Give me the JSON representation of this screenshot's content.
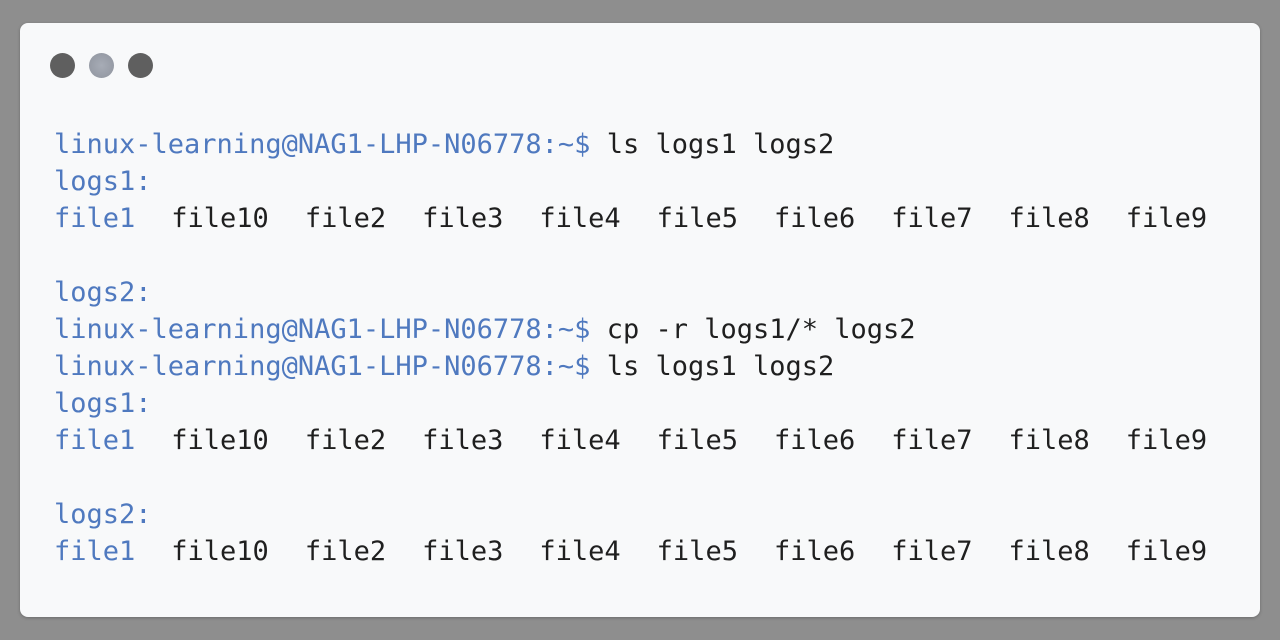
{
  "window": {
    "controls": [
      "close",
      "minimize",
      "maximize"
    ]
  },
  "colors": {
    "prompt": "#4f79bf",
    "text": "#1f1f1f",
    "window_bg": "#f8f9fa",
    "desktop_bg": "#8e8e8e"
  },
  "terminal": {
    "prompt": "linux-learning@NAG1-LHP-N06778:~$",
    "blocks": [
      {
        "type": "command",
        "text": "ls logs1 logs2"
      },
      {
        "type": "dir",
        "text": "logs1:"
      },
      {
        "type": "files",
        "items": [
          "file1",
          "file10",
          "file2",
          "file3",
          "file4",
          "file5",
          "file6",
          "file7",
          "file8",
          "file9"
        ]
      },
      {
        "type": "blank"
      },
      {
        "type": "dir",
        "text": "logs2:"
      },
      {
        "type": "command",
        "text": "cp -r logs1/* logs2"
      },
      {
        "type": "command",
        "text": "ls logs1 logs2"
      },
      {
        "type": "dir",
        "text": "logs1:"
      },
      {
        "type": "files",
        "items": [
          "file1",
          "file10",
          "file2",
          "file3",
          "file4",
          "file5",
          "file6",
          "file7",
          "file8",
          "file9"
        ]
      },
      {
        "type": "blank"
      },
      {
        "type": "dir",
        "text": "logs2:"
      },
      {
        "type": "files",
        "items": [
          "file1",
          "file10",
          "file2",
          "file3",
          "file4",
          "file5",
          "file6",
          "file7",
          "file8",
          "file9"
        ]
      }
    ]
  }
}
